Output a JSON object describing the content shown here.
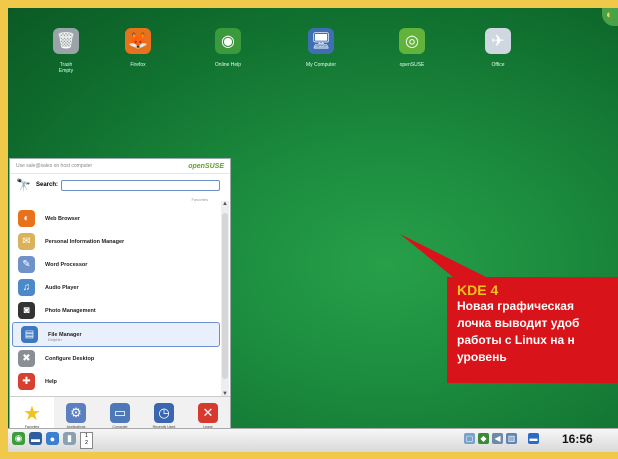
{
  "desktop": {
    "icons": [
      {
        "label": "Trash\nEmpty",
        "icon": "trash-icon",
        "glyph": "🗑",
        "color": "#9aa3a8"
      },
      {
        "label": "Firefox",
        "icon": "firefox-icon",
        "glyph": "🦊",
        "color": "#e8721c"
      },
      {
        "label": "Online Help",
        "icon": "help-icon",
        "glyph": "◉",
        "color": "#3b9a3b"
      },
      {
        "label": "My Computer",
        "icon": "computer-icon",
        "glyph": "🖥",
        "color": "#3f6fb3"
      },
      {
        "label": "openSUSE",
        "icon": "opensuse-icon",
        "glyph": "◎",
        "color": "#61b33b"
      },
      {
        "label": "Office",
        "icon": "office-icon",
        "glyph": "✈",
        "color": "#cfd8e0"
      }
    ]
  },
  "menu": {
    "top_hint": "Use sale@sales on host computer",
    "brand": "openSUSE",
    "search_label": "Search:",
    "search_value": "",
    "favorites_caption": "Favorites",
    "items": [
      {
        "label": "Web Browser",
        "sub": "",
        "icon": "firefox-icon",
        "glyph": "◐",
        "color": "#e8721c"
      },
      {
        "label": "Personal Information Manager",
        "sub": "",
        "icon": "pim-icon",
        "glyph": "✉",
        "color": "#d9b25b"
      },
      {
        "label": "Word Processor",
        "sub": "",
        "icon": "word-processor-icon",
        "glyph": "✎",
        "color": "#6f92c8"
      },
      {
        "label": "Audio Player",
        "sub": "",
        "icon": "audio-player-icon",
        "glyph": "♫",
        "color": "#4b89c9"
      },
      {
        "label": "Photo Management",
        "sub": "",
        "icon": "camera-icon",
        "glyph": "◙",
        "color": "#333333"
      },
      {
        "label": "File Manager",
        "sub": "Dolphin",
        "icon": "file-manager-icon",
        "glyph": "▤",
        "color": "#3d77c2"
      },
      {
        "label": "Configure Desktop",
        "sub": "",
        "icon": "configure-icon",
        "glyph": "✖",
        "color": "#8b8f94"
      },
      {
        "label": "Help",
        "sub": "",
        "icon": "lifebuoy-icon",
        "glyph": "✚",
        "color": "#d8412f"
      }
    ],
    "tabs": [
      {
        "label": "Favorites",
        "icon": "star-icon",
        "glyph": "★",
        "color": "#f2c11d"
      },
      {
        "label": "Applications",
        "icon": "applications-icon",
        "glyph": "⚙",
        "color": "#5b7fbf"
      },
      {
        "label": "Computer",
        "icon": "computer-tab-icon",
        "glyph": "▭",
        "color": "#4f78b8"
      },
      {
        "label": "Recently Used",
        "icon": "recent-icon",
        "glyph": "◷",
        "color": "#3b67b0"
      },
      {
        "label": "Leave",
        "icon": "leave-icon",
        "glyph": "✕",
        "color": "#d63a2f"
      }
    ]
  },
  "callout": {
    "title": "KDE 4",
    "lines": [
      "Новая графическая",
      "лочка выводит удоб",
      "работы с Linux на н",
      "уровень"
    ]
  },
  "taskbar": {
    "left_icons": [
      {
        "icon": "kde-menu-icon",
        "glyph": "◉",
        "color": "#3f9c3a"
      },
      {
        "icon": "desktop-icon",
        "glyph": "▬",
        "color": "#2e5e9e"
      },
      {
        "icon": "globe-icon",
        "glyph": "●",
        "color": "#3b7fd1"
      },
      {
        "icon": "trash-small-icon",
        "glyph": "▮",
        "color": "#8aa0b3"
      }
    ],
    "pager": [
      "1",
      "2"
    ],
    "tray_icons": [
      {
        "icon": "network-icon",
        "glyph": "▢",
        "color": "#7aa0cc"
      },
      {
        "icon": "update-icon",
        "glyph": "◆",
        "color": "#3a8a3a"
      },
      {
        "icon": "volume-icon",
        "glyph": "◀",
        "color": "#6d8aa8"
      },
      {
        "icon": "clipboard-icon",
        "glyph": "▥",
        "color": "#5f84b5"
      },
      {
        "icon": "battery-icon",
        "glyph": "▬",
        "color": "#2a6cc4"
      }
    ],
    "clock": "16:56"
  },
  "colors": {
    "desktop_green": "#1b8a3d",
    "callout_red": "#d8131a",
    "callout_title": "#f3c21a",
    "frame_yellow": "#f1c94a"
  }
}
